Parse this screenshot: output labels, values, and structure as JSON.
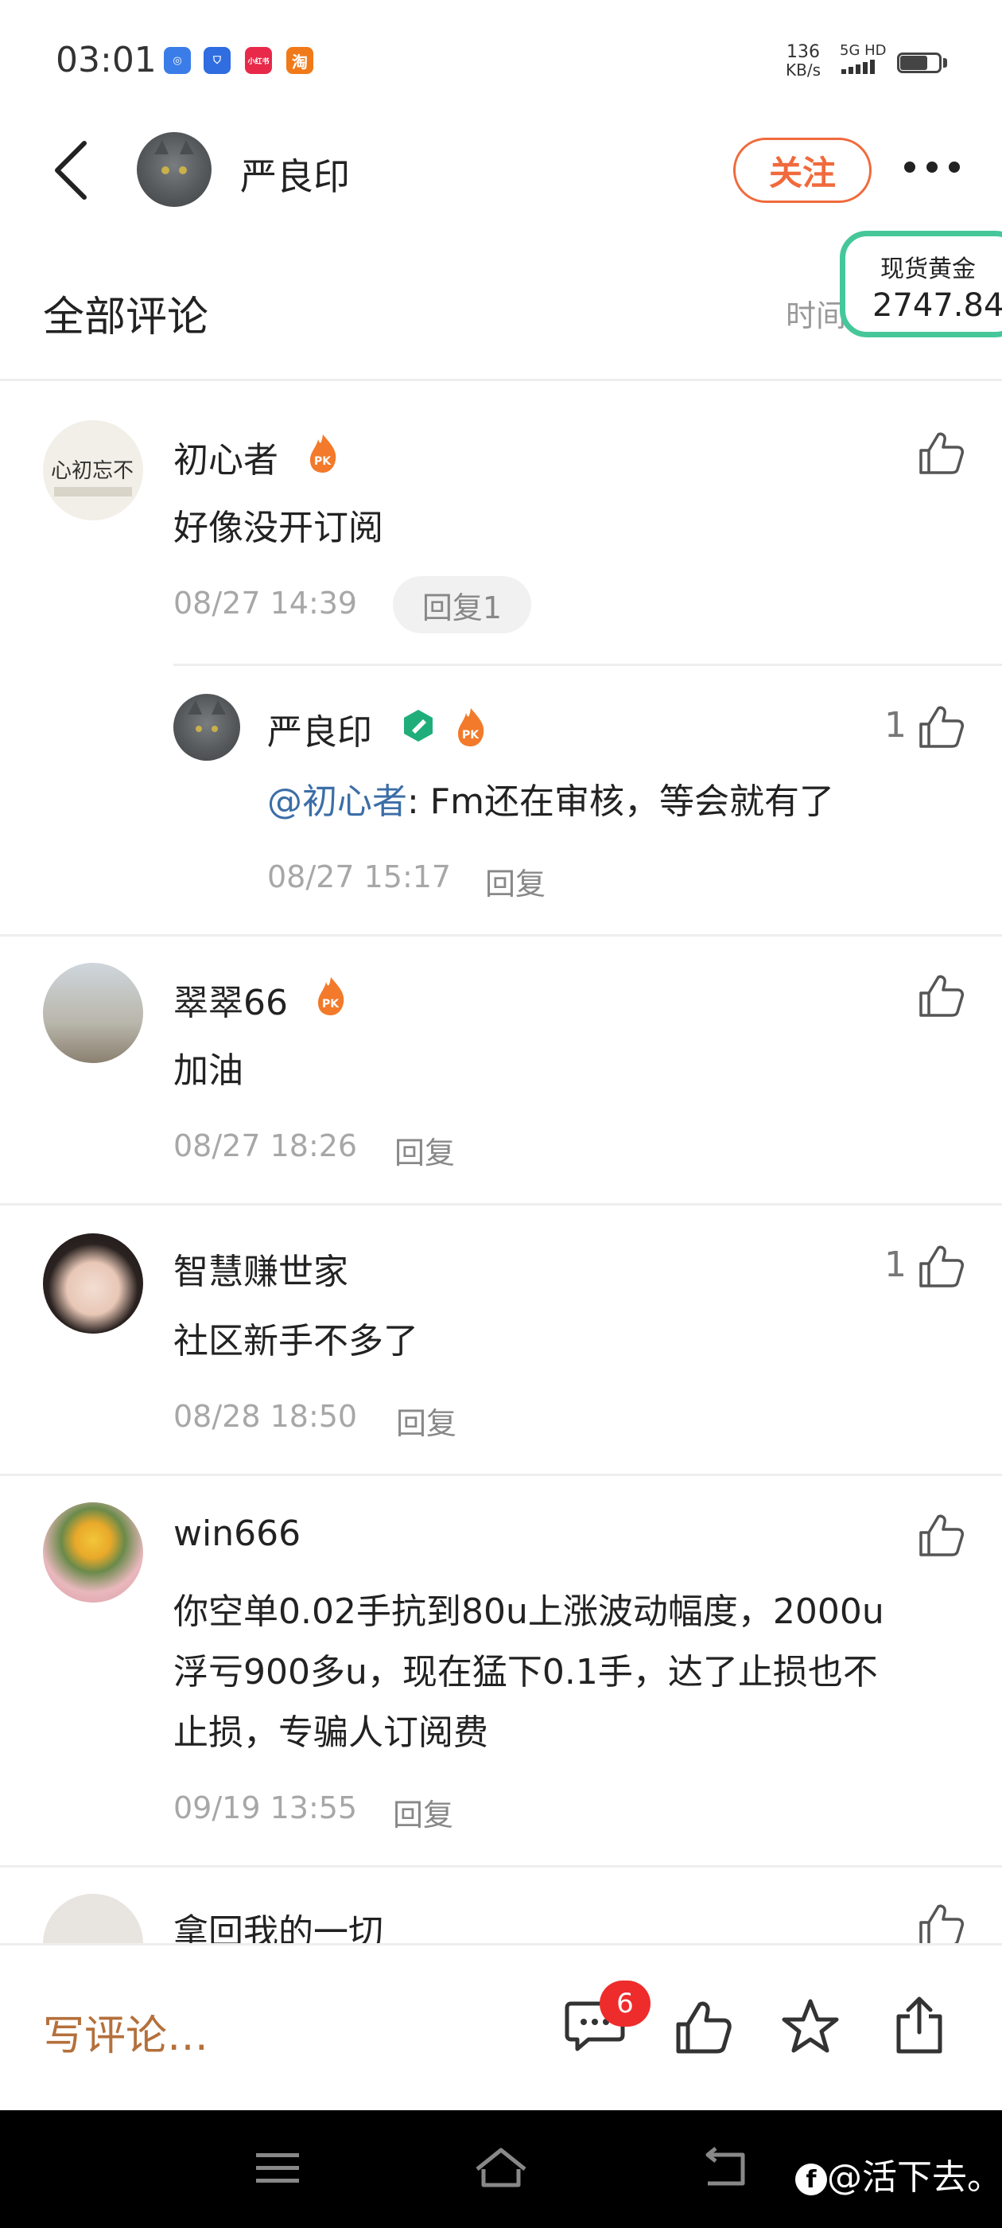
{
  "status_bar": {
    "time": "03:01",
    "apps": [
      {
        "name": "app-blue",
        "glyph": "◎",
        "color": "#3b7de8"
      },
      {
        "name": "app-shield",
        "glyph": "⛉",
        "color": "#2f6de0"
      },
      {
        "name": "app-red",
        "glyph": "小红书",
        "color": "#e8294a"
      },
      {
        "name": "app-taobao",
        "glyph": "淘",
        "color": "#f07a1a"
      }
    ],
    "net_speed": "136",
    "net_unit": "KB/s",
    "network": "5G HD"
  },
  "header": {
    "author": "严良印",
    "follow_label": "关注"
  },
  "gold_widget": {
    "title": "现货黄金",
    "price": "2747.84"
  },
  "comments_section": {
    "title": "全部评论",
    "sort_label": "时间正序"
  },
  "comments": [
    {
      "user": "初心者",
      "text": "好像没开订阅",
      "time": "08/27 14:39",
      "reply_label": "回复1",
      "likes": ""
    },
    {
      "user": "翠翠66",
      "text": "加油",
      "time": "08/27 18:26",
      "reply_label": "回复",
      "likes": ""
    },
    {
      "user": "智慧赚世家",
      "text": "社区新手不多了",
      "time": "08/28 18:50",
      "reply_label": "回复",
      "likes": "1"
    },
    {
      "user": "win666",
      "text_lines": [
        "你空单0.02手抗到80u上涨波动幅度，2000u",
        "浮亏900多u，现在猛下0.1手，达了止损也不",
        "止损，专骗人订阅费"
      ],
      "time": "09/19 13:55",
      "reply_label": "回复",
      "likes": ""
    },
    {
      "user": "拿回我的一切",
      "likes": ""
    }
  ],
  "sub_reply": {
    "user": "严良印",
    "mention": "@初心者",
    "text": ": Fm还在审核，等会就有了",
    "time": "08/27 15:17",
    "reply_label": "回复",
    "likes": "1"
  },
  "bottom_bar": {
    "write_placeholder": "写评论…",
    "comment_badge": "6"
  },
  "watermark": "@活下去。",
  "colors": {
    "accent": "#f06a3c",
    "gold_border": "#45c79a",
    "mention": "#3c6ea7",
    "badge": "#ee2c2c"
  }
}
